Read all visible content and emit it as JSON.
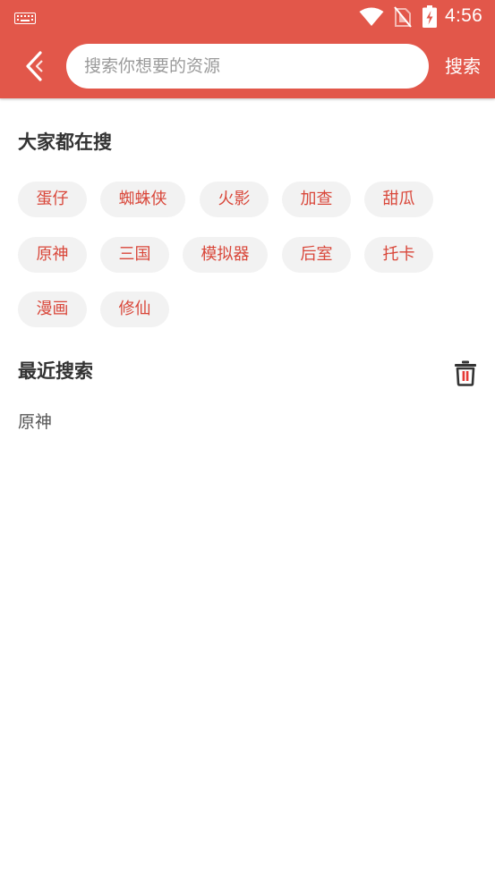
{
  "status_bar": {
    "time": "4:56",
    "icons": [
      "keyboard-icon",
      "wifi-icon",
      "no-sim-icon",
      "battery-charging-icon"
    ]
  },
  "header": {
    "search_placeholder": "搜索你想要的资源",
    "search_button_label": "搜索"
  },
  "hot": {
    "title": "大家都在搜",
    "tags": [
      "蛋仔",
      "蜘蛛侠",
      "火影",
      "加查",
      "甜瓜",
      "原神",
      "三国",
      "模拟器",
      "后室",
      "托卡",
      "漫画",
      "修仙"
    ]
  },
  "recent": {
    "title": "最近搜索",
    "items": [
      "原神"
    ]
  },
  "colors": {
    "primary": "#e2574a",
    "tag_text": "#d9473a",
    "tag_background": "#f2f2f2",
    "title_text": "#333333"
  }
}
